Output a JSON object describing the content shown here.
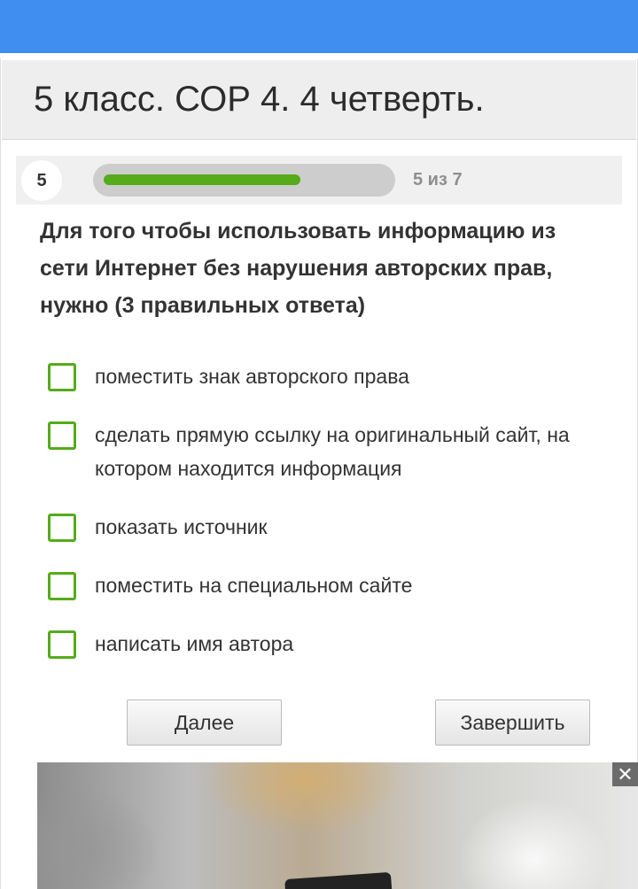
{
  "header": {
    "title": "5 класс. СОР 4. 4 четверть."
  },
  "progress": {
    "question_number": "5",
    "text": "5 из 7",
    "fraction": 0.7
  },
  "question": {
    "text": "Для того чтобы использовать информацию из сети Интернет без нарушения авторских прав, нужно (3 правильных ответа)",
    "options": [
      {
        "label": "поместить знак авторского права",
        "checked": false
      },
      {
        "label": "сделать прямую ссылку на оригинальный сайт, на котором находится информация",
        "checked": false
      },
      {
        "label": "показать источник",
        "checked": false
      },
      {
        "label": "поместить на специальном сайте",
        "checked": false
      },
      {
        "label": "написать имя автора",
        "checked": false
      }
    ]
  },
  "buttons": {
    "next_label": "Далее",
    "finish_label": "Завершить"
  },
  "ad": {
    "close_symbol": "✕"
  },
  "colors": {
    "topbar": "#3f8ef0",
    "accent_green": "#55ab1a"
  }
}
